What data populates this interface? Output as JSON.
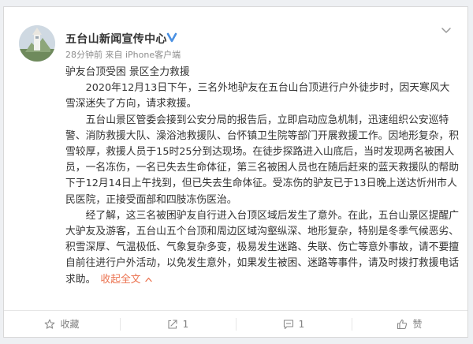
{
  "post": {
    "author": "五台山新闻宣传中心",
    "meta": "28分钟前 来自 iPhone客户端",
    "title": "驴友台顶受困  景区全力救援",
    "paragraphs": [
      "2020年12月13日下午，三名外地驴友在五台山台顶进行户外徒步时，因天寒风大雪深迷失了方向，请求救援。",
      "五台山景区管委会接到公安分局的报告后，立即启动应急机制，迅速组织公安巡特警、消防救援大队、澡浴池救援队、台怀镇卫生院等部门开展救援工作。因地形复杂，积雪较厚，救援人员于15时25分到达现场。在徒步探路进入山底后，当时发现两名被困人员，一名冻伤，一名已失去生命体征，第三名被困人员也在随后赶来的蓝天救援队的帮助下于12月14日上午找到，但已失去生命体征。受冻伤的驴友已于13日晚上送达忻州市人民医院，正接受面部和四肢冻伤医治。",
      "经了解，这三名被困驴友自行进入台顶区域后发生了意外。在此，五台山景区提醒广大驴友及游客，五台山五个台顶和周边区域沟壑纵深、地形复杂，特别是冬季气候恶劣、积雪深厚、气温极低、气象复杂多变，极易发生迷路、失联、伤亡等意外事故，请不要擅自前往进行户外活动，以免发生意外，如果发生被困、迷路等事件，请及时拨打救援电话求助。"
    ],
    "collapse_label": "收起全文"
  },
  "actions": {
    "favorite": "收藏",
    "repost": "1",
    "comment": "1",
    "like": "赞"
  },
  "colors": {
    "link": "#eb7350",
    "verified": "#4a90e2",
    "text": "#333333",
    "muted": "#808080"
  }
}
